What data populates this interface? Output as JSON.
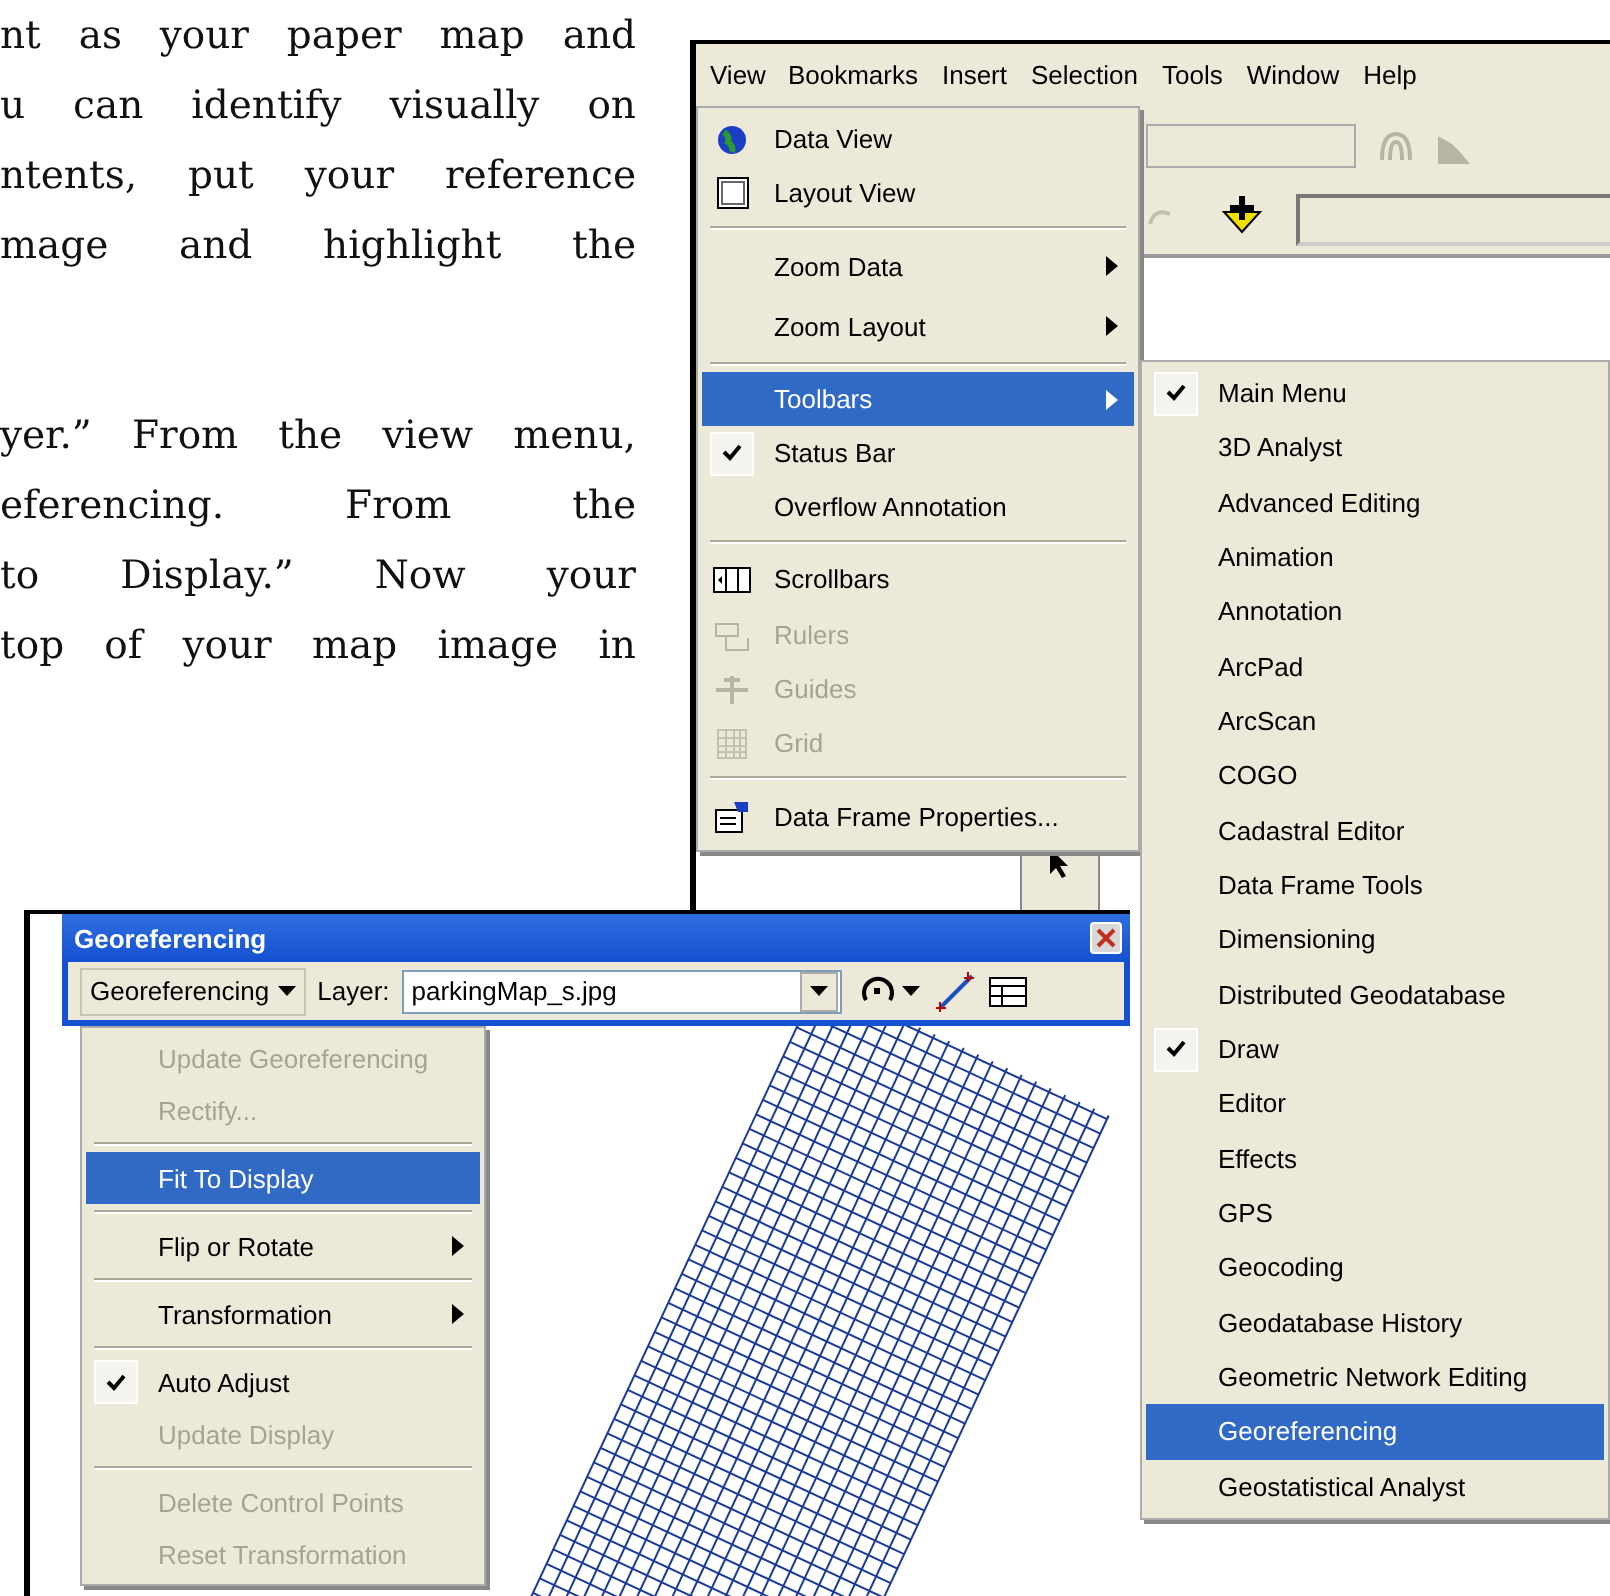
{
  "document": {
    "paragraphs": [
      {
        "lines": [
          "nt as your paper map and",
          "u can identify visually on",
          "ntents, put your reference",
          "mage and highlight the"
        ]
      },
      {
        "lines": [
          "yer.” From the view menu,",
          "eferencing. From the",
          "to Display.” Now your",
          "top of your map image in"
        ]
      }
    ]
  },
  "arcmap": {
    "menu_bar": [
      {
        "label": "View",
        "selected": true
      },
      {
        "label": "Bookmarks",
        "selected": false
      },
      {
        "label": "Insert",
        "selected": false
      },
      {
        "label": "Selection",
        "selected": false
      },
      {
        "label": "Tools",
        "selected": false
      },
      {
        "label": "Window",
        "selected": false
      },
      {
        "label": "Help",
        "selected": false
      }
    ],
    "view_menu": [
      {
        "kind": "item",
        "label": "Data View",
        "checked": false,
        "disabled": false,
        "submenu": false,
        "selected": false
      },
      {
        "kind": "item",
        "label": "Layout View",
        "checked": false,
        "disabled": false,
        "submenu": false,
        "selected": false
      },
      {
        "kind": "separator"
      },
      {
        "kind": "item",
        "label": "Zoom Data",
        "checked": false,
        "disabled": false,
        "submenu": true,
        "selected": false
      },
      {
        "kind": "item",
        "label": "Zoom Layout",
        "checked": false,
        "disabled": false,
        "submenu": true,
        "selected": false
      },
      {
        "kind": "separator"
      },
      {
        "kind": "item",
        "label": "Toolbars",
        "checked": false,
        "disabled": false,
        "submenu": true,
        "selected": true
      },
      {
        "kind": "item",
        "label": "Status Bar",
        "checked": true,
        "disabled": false,
        "submenu": false,
        "selected": false
      },
      {
        "kind": "item",
        "label": "Overflow Annotation",
        "checked": false,
        "disabled": false,
        "submenu": false,
        "selected": false
      },
      {
        "kind": "separator"
      },
      {
        "kind": "item",
        "label": "Scrollbars",
        "checked": false,
        "disabled": false,
        "submenu": false,
        "selected": false
      },
      {
        "kind": "item",
        "label": "Rulers",
        "checked": false,
        "disabled": true,
        "submenu": false,
        "selected": false
      },
      {
        "kind": "item",
        "label": "Guides",
        "checked": false,
        "disabled": true,
        "submenu": false,
        "selected": false
      },
      {
        "kind": "item",
        "label": "Grid",
        "checked": false,
        "disabled": true,
        "submenu": false,
        "selected": false
      },
      {
        "kind": "separator"
      },
      {
        "kind": "item",
        "label": "Data Frame Properties...",
        "checked": false,
        "disabled": false,
        "submenu": false,
        "selected": false
      }
    ],
    "toolbars_menu": [
      {
        "label": "Main Menu",
        "checked": true,
        "selected": false
      },
      {
        "label": "3D Analyst",
        "checked": false,
        "selected": false
      },
      {
        "label": "Advanced Editing",
        "checked": false,
        "selected": false
      },
      {
        "label": "Animation",
        "checked": false,
        "selected": false
      },
      {
        "label": "Annotation",
        "checked": false,
        "selected": false
      },
      {
        "label": "ArcPad",
        "checked": false,
        "selected": false
      },
      {
        "label": "ArcScan",
        "checked": false,
        "selected": false
      },
      {
        "label": "COGO",
        "checked": false,
        "selected": false
      },
      {
        "label": "Cadastral Editor",
        "checked": false,
        "selected": false
      },
      {
        "label": "Data Frame Tools",
        "checked": false,
        "selected": false
      },
      {
        "label": "Dimensioning",
        "checked": false,
        "selected": false
      },
      {
        "label": "Distributed Geodatabase",
        "checked": false,
        "selected": false
      },
      {
        "label": "Draw",
        "checked": true,
        "selected": false
      },
      {
        "label": "Editor",
        "checked": false,
        "selected": false
      },
      {
        "label": "Effects",
        "checked": false,
        "selected": false
      },
      {
        "label": "GPS",
        "checked": false,
        "selected": false
      },
      {
        "label": "Geocoding",
        "checked": false,
        "selected": false
      },
      {
        "label": "Geodatabase History",
        "checked": false,
        "selected": false
      },
      {
        "label": "Geometric Network Editing",
        "checked": false,
        "selected": false
      },
      {
        "label": "Georeferencing",
        "checked": false,
        "selected": true
      },
      {
        "label": "Geostatistical Analyst",
        "checked": false,
        "selected": false
      }
    ]
  },
  "georeferencing": {
    "title": "Georeferencing",
    "menu_button": "Georeferencing",
    "layer_label": "Layer:",
    "layer_value": "parkingMap_s.jpg",
    "menu": [
      {
        "kind": "item",
        "label": "Update Georeferencing",
        "checked": false,
        "disabled": true,
        "submenu": false,
        "selected": false
      },
      {
        "kind": "item",
        "label": "Rectify...",
        "checked": false,
        "disabled": true,
        "submenu": false,
        "selected": false
      },
      {
        "kind": "separator"
      },
      {
        "kind": "item",
        "label": "Fit To Display",
        "checked": false,
        "disabled": false,
        "submenu": false,
        "selected": true
      },
      {
        "kind": "separator"
      },
      {
        "kind": "item",
        "label": "Flip or Rotate",
        "checked": false,
        "disabled": false,
        "submenu": true,
        "selected": false
      },
      {
        "kind": "separator"
      },
      {
        "kind": "item",
        "label": "Transformation",
        "checked": false,
        "disabled": false,
        "submenu": true,
        "selected": false
      },
      {
        "kind": "separator"
      },
      {
        "kind": "item",
        "label": "Auto Adjust",
        "checked": true,
        "disabled": false,
        "submenu": false,
        "selected": false
      },
      {
        "kind": "item",
        "label": "Update Display",
        "checked": false,
        "disabled": true,
        "submenu": false,
        "selected": false
      },
      {
        "kind": "separator"
      },
      {
        "kind": "item",
        "label": "Delete Control Points",
        "checked": false,
        "disabled": true,
        "submenu": false,
        "selected": false
      },
      {
        "kind": "item",
        "label": "Reset Transformation",
        "checked": false,
        "disabled": true,
        "submenu": false,
        "selected": false
      }
    ]
  }
}
